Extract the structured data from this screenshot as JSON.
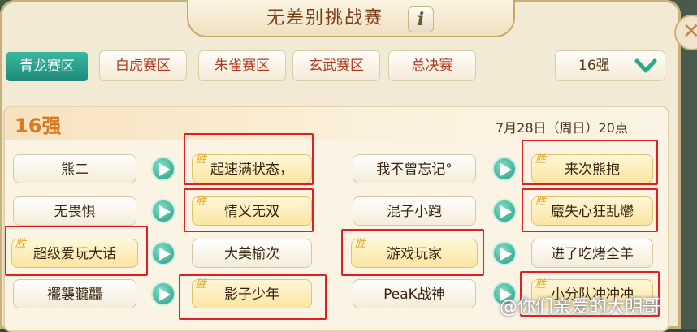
{
  "window": {
    "title": "无差别挑战赛",
    "info_icon_label": "i"
  },
  "tabs": [
    {
      "label": "青龙赛区",
      "active": true
    },
    {
      "label": "白虎赛区",
      "active": false
    },
    {
      "label": "朱雀赛区",
      "active": false
    },
    {
      "label": "玄武赛区",
      "active": false
    },
    {
      "label": "总决赛",
      "active": false
    }
  ],
  "dropdown": {
    "selected": "16强"
  },
  "round": {
    "title": "16强",
    "schedule": "7月28日（周日）20点"
  },
  "win_label": "胜",
  "matches": [
    {
      "left": "熊二",
      "right": "起速满状态，",
      "winner": "right",
      "highlight": "right"
    },
    {
      "left": "无畏惧",
      "right": "情义无双",
      "winner": "right",
      "highlight": "right"
    },
    {
      "left": "超级爱玩大话",
      "right": "大美榆次",
      "winner": "left",
      "highlight": "left"
    },
    {
      "left": "襬襲龖龘",
      "right": "影子少年",
      "winner": "right",
      "highlight": "right"
    },
    {
      "left": "我不曾忘记°",
      "right": "来次熊抱",
      "winner": "right",
      "highlight": "right"
    },
    {
      "left": "混子小跑",
      "right": "黀失心狂乱爩",
      "winner": "right",
      "highlight": "right"
    },
    {
      "left": "游戏玩家",
      "right": "进了吃烤全羊",
      "winner": "left",
      "highlight": "left"
    },
    {
      "left": "PeaK战神",
      "right": "小分队冲冲冲",
      "winner": "right",
      "highlight": "right"
    }
  ],
  "watermark": "@你们亲爱的大明哥",
  "colors": {
    "accent_teal": "#1f8a7a",
    "tab_text_red": "#b33a1f",
    "highlight_red": "#e02020",
    "round_orange": "#d87a20"
  }
}
